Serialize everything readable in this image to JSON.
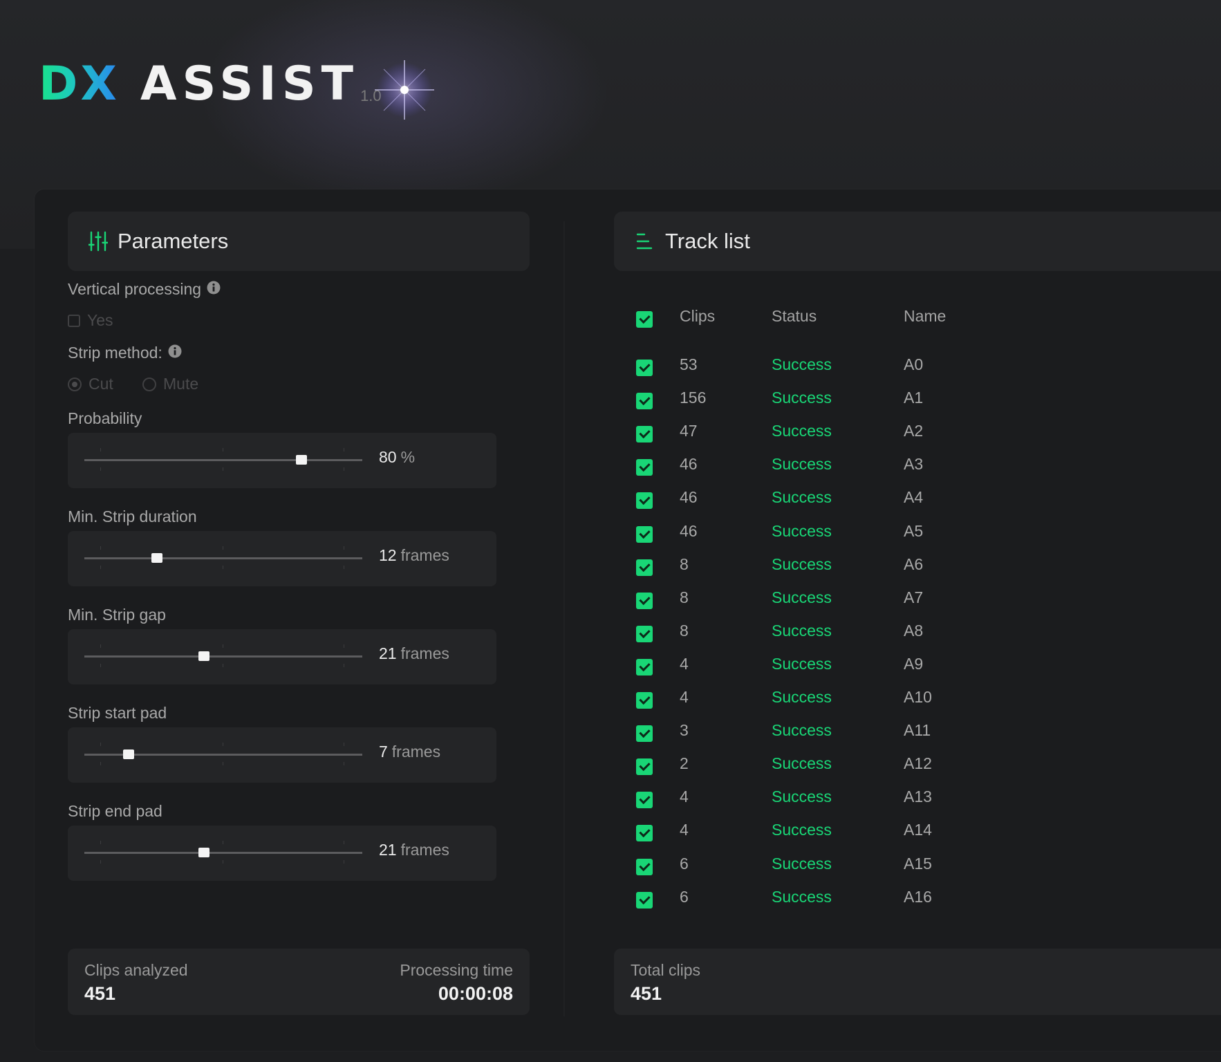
{
  "app": {
    "logo_dx": "DX",
    "logo_assist": "ASSIST",
    "version": "1.0"
  },
  "parameters": {
    "title": "Parameters",
    "vertical_processing": {
      "label": "Vertical processing",
      "option": "Yes",
      "checked": false
    },
    "strip_method": {
      "label": "Strip method:",
      "options": [
        "Cut",
        "Mute"
      ],
      "selected": "Cut"
    },
    "sliders": [
      {
        "label": "Probability",
        "value": "80",
        "unit": "%",
        "fraction": 0.78
      },
      {
        "label": "Min. Strip duration",
        "value": "12",
        "unit": "frames",
        "fraction": 0.26
      },
      {
        "label": "Min. Strip gap",
        "value": "21",
        "unit": "frames",
        "fraction": 0.43
      },
      {
        "label": "Strip start pad",
        "value": "7",
        "unit": "frames",
        "fraction": 0.16
      },
      {
        "label": "Strip end pad",
        "value": "21",
        "unit": "frames",
        "fraction": 0.43
      }
    ],
    "stats": {
      "clips_analyzed_label": "Clips analyzed",
      "clips_analyzed": "451",
      "processing_time_label": "Processing time",
      "processing_time": "00:00:08"
    }
  },
  "track_list": {
    "title": "Track list",
    "columns": {
      "clips": "Clips",
      "status": "Status",
      "name": "Name"
    },
    "rows": [
      {
        "clips": "53",
        "status": "Success",
        "name": "A0"
      },
      {
        "clips": "156",
        "status": "Success",
        "name": "A1"
      },
      {
        "clips": "47",
        "status": "Success",
        "name": "A2"
      },
      {
        "clips": "46",
        "status": "Success",
        "name": "A3"
      },
      {
        "clips": "46",
        "status": "Success",
        "name": "A4"
      },
      {
        "clips": "46",
        "status": "Success",
        "name": "A5"
      },
      {
        "clips": "8",
        "status": "Success",
        "name": "A6"
      },
      {
        "clips": "8",
        "status": "Success",
        "name": "A7"
      },
      {
        "clips": "8",
        "status": "Success",
        "name": "A8"
      },
      {
        "clips": "4",
        "status": "Success",
        "name": "A9"
      },
      {
        "clips": "4",
        "status": "Success",
        "name": "A10"
      },
      {
        "clips": "3",
        "status": "Success",
        "name": "A11"
      },
      {
        "clips": "2",
        "status": "Success",
        "name": "A12"
      },
      {
        "clips": "4",
        "status": "Success",
        "name": "A13"
      },
      {
        "clips": "4",
        "status": "Success",
        "name": "A14"
      },
      {
        "clips": "6",
        "status": "Success",
        "name": "A15"
      },
      {
        "clips": "6",
        "status": "Success",
        "name": "A16"
      }
    ],
    "total_label": "Total clips",
    "total": "451"
  },
  "colors": {
    "accent": "#19d676",
    "background": "#1d1e20",
    "card": "#242527"
  },
  "icons": {
    "parameters": "sliders-icon",
    "track_list": "list-icon",
    "info": "info-icon"
  }
}
